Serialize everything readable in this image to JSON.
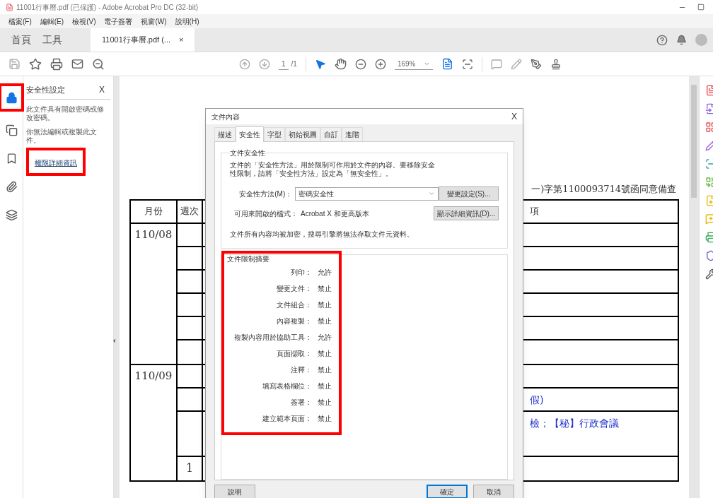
{
  "window": {
    "title": "11001行事曆.pdf (已保護) - Adobe Acrobat Pro DC (32-bit)"
  },
  "menu": [
    "檔案(F)",
    "編輯(E)",
    "檢視(V)",
    "電子簽署",
    "視窗(W)",
    "說明(H)"
  ],
  "app_tabs": [
    {
      "label": "首頁",
      "selected": false
    },
    {
      "label": "工具",
      "selected": false
    }
  ],
  "doc_tab": {
    "label": "11001行事曆.pdf (...",
    "close": "×"
  },
  "toolbar": {
    "page": "1",
    "page_total": "/1",
    "zoom": "169%"
  },
  "side_rail": [
    {
      "kind": "lock",
      "selected": true
    },
    {
      "kind": "pages",
      "selected": false
    },
    {
      "kind": "bookmark",
      "selected": false
    },
    {
      "kind": "attach",
      "selected": false
    },
    {
      "kind": "layers",
      "selected": false
    }
  ],
  "security_panel": {
    "title": "安全性設定",
    "close": "X",
    "lines": [
      "此文件具有開啟密碼或修改密碼。",
      "你無法編輯或複製此文件。"
    ],
    "link": "權限詳細資訊"
  },
  "document": {
    "heading": "一)字第1100093714號函同意備查",
    "columns": [
      "月份",
      "週次",
      "項"
    ],
    "groups": [
      {
        "month": "110/08",
        "rows": [
          {
            "week": "",
            "item": ""
          },
          {
            "week": "",
            "item": ""
          },
          {
            "week": "",
            "item": ""
          },
          {
            "week": "",
            "item": ""
          },
          {
            "week": "",
            "item": ""
          },
          {
            "week": "",
            "item": ""
          }
        ]
      },
      {
        "month": "110/09",
        "rows": [
          {
            "week": "",
            "item": ""
          },
          {
            "week": "",
            "item": "假)"
          },
          {
            "week": "",
            "item": "檢；【秘】行政會議",
            "tall": true
          },
          {
            "week": "1",
            "item": ""
          }
        ]
      }
    ]
  },
  "dialog": {
    "title": "文件內容",
    "close": "X",
    "tabs": [
      {
        "label": "描述",
        "selected": false
      },
      {
        "label": "安全性",
        "selected": true
      },
      {
        "label": "字型",
        "selected": false
      },
      {
        "label": "初始視圖",
        "selected": false
      },
      {
        "label": "自訂",
        "selected": false
      },
      {
        "label": "進階",
        "selected": false
      }
    ],
    "security": {
      "legend": "文件安全性",
      "description": "文件的「安全性方法」用於限制可作用於文件的內容。要移除安全性限制，請將「安全性方法」設定為「無安全性」。",
      "method_label": "安全性方法(M)：",
      "method_value": "密碼安全性",
      "change_button": "變更設定(S)...",
      "compat_label": "可用來開啟的檔式：",
      "compat_value": "Acrobat X 和更高版本",
      "details_button": "顯示詳細資訊(D)...",
      "note": "文件所有內容均被加密，搜尋引擎將無法存取文件元資料。"
    },
    "summary": {
      "legend": "文件限制摘要",
      "rows": [
        {
          "label": "列印：",
          "value": "允許"
        },
        {
          "label": "變更文件：",
          "value": "禁止"
        },
        {
          "label": "文件組合：",
          "value": "禁止"
        },
        {
          "label": "內容複製：",
          "value": "禁止"
        },
        {
          "label": "複製內容用於協助工具：",
          "value": "允許"
        },
        {
          "label": "頁面擷取：",
          "value": "禁止"
        },
        {
          "label": "注釋：",
          "value": "禁止"
        },
        {
          "label": "填寫表格欄位：",
          "value": "禁止"
        },
        {
          "label": "簽署：",
          "value": "禁止"
        },
        {
          "label": "建立範本頁面：",
          "value": "禁止"
        }
      ]
    },
    "buttons": [
      {
        "label": "說明",
        "kind": "help"
      },
      {
        "label": "確定",
        "kind": "ok"
      },
      {
        "label": "取消",
        "kind": "cancel"
      }
    ]
  }
}
